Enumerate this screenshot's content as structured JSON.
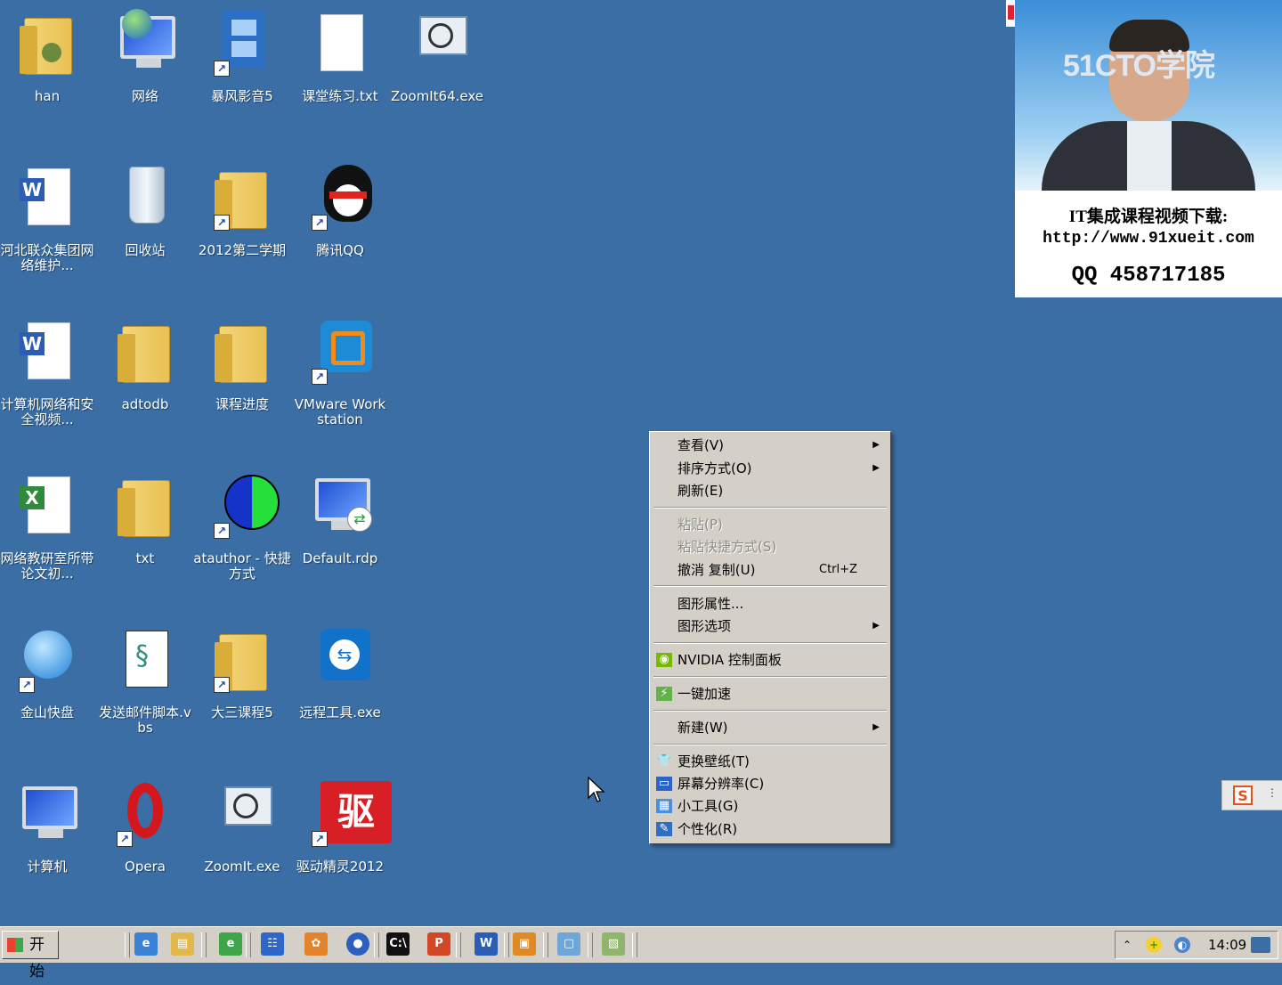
{
  "desktop_icons": [
    {
      "label": "han",
      "icon": "user-folder-icon"
    },
    {
      "label": "网络",
      "icon": "network-globe-icon"
    },
    {
      "label": "暴风影音5",
      "icon": "film-player-icon"
    },
    {
      "label": "课堂练习.txt",
      "icon": "text-file-icon"
    },
    {
      "label": "ZoomIt64.exe",
      "icon": "zoom-magnifier-icon"
    },
    {
      "label": "河北联众集团网络维护...",
      "icon": "word-document-icon"
    },
    {
      "label": "回收站",
      "icon": "recycle-bin-icon"
    },
    {
      "label": "2012第二学期",
      "icon": "folder-icon"
    },
    {
      "label": "腾讯QQ",
      "icon": "qq-penguin-icon"
    },
    {
      "label": "计算机网络和安全视频...",
      "icon": "word-document-icon"
    },
    {
      "label": "adtodb",
      "icon": "folder-icon"
    },
    {
      "label": "课程进度",
      "icon": "folder-icon"
    },
    {
      "label": "VMware Workstation",
      "icon": "vmware-icon"
    },
    {
      "label": "网络教研室所带论文初...",
      "icon": "excel-document-icon"
    },
    {
      "label": "txt",
      "icon": "folder-icon"
    },
    {
      "label": "atauthor - 快捷方式",
      "icon": "pie-circle-icon"
    },
    {
      "label": "Default.rdp",
      "icon": "remote-desktop-icon"
    },
    {
      "label": "金山快盘",
      "icon": "kuaipan-icon"
    },
    {
      "label": "发送邮件脚本.vbs",
      "icon": "vbs-script-icon"
    },
    {
      "label": "大三课程5",
      "icon": "folder-icon"
    },
    {
      "label": "远程工具.exe",
      "icon": "teamviewer-icon"
    },
    {
      "label": "计算机",
      "icon": "computer-icon"
    },
    {
      "label": "Opera",
      "icon": "opera-icon"
    },
    {
      "label": "ZoomIt.exe",
      "icon": "zoom-magnifier-icon"
    },
    {
      "label": "驱动精灵2012",
      "icon": "driver-genius-icon"
    }
  ],
  "context_menu": {
    "items": [
      {
        "label": "查看(V)",
        "submenu": true,
        "disabled": false
      },
      {
        "label": "排序方式(O)",
        "submenu": true,
        "disabled": false
      },
      {
        "label": "刷新(E)",
        "submenu": false,
        "disabled": false
      },
      {
        "label": "粘贴(P)",
        "submenu": false,
        "disabled": true
      },
      {
        "label": "粘贴快捷方式(S)",
        "submenu": false,
        "disabled": true
      },
      {
        "label": "撤消 复制(U)",
        "shortcut": "Ctrl+Z",
        "submenu": false,
        "disabled": false
      },
      {
        "label": "图形属性...",
        "submenu": false,
        "disabled": false
      },
      {
        "label": "图形选项",
        "submenu": true,
        "disabled": false
      },
      {
        "label": "NVIDIA 控制面板",
        "submenu": false,
        "disabled": false,
        "icon": "nvidia-icon"
      },
      {
        "label": "一键加速",
        "submenu": false,
        "disabled": false,
        "icon": "speedup-icon"
      },
      {
        "label": "新建(W)",
        "submenu": true,
        "disabled": false
      },
      {
        "label": "更换壁纸(T)",
        "submenu": false,
        "disabled": false,
        "icon": "wallpaper-icon"
      },
      {
        "label": "屏幕分辨率(C)",
        "submenu": false,
        "disabled": false,
        "icon": "display-icon"
      },
      {
        "label": "小工具(G)",
        "submenu": false,
        "disabled": false,
        "icon": "gadgets-icon"
      },
      {
        "label": "个性化(R)",
        "submenu": false,
        "disabled": false,
        "icon": "personalize-icon"
      }
    ]
  },
  "webcam_overlay": {
    "logo": "51CTO学院",
    "line1": "IT集成课程视频下载:",
    "line2": "http://www.91xueit.com",
    "line3": "QQ 458717185"
  },
  "ime": {
    "glyph": "S"
  },
  "taskbar": {
    "start_label": "开始",
    "clock": "14:09",
    "quick_launch": [
      "ie-icon",
      "explorer-icon",
      "ie-alt-icon",
      "panel-icon",
      "paint-icon",
      "media-icon"
    ],
    "apps": [
      "cmd-icon",
      "powerpoint-icon",
      "word-icon",
      "app-icon",
      "window-icon",
      "map-icon"
    ]
  }
}
